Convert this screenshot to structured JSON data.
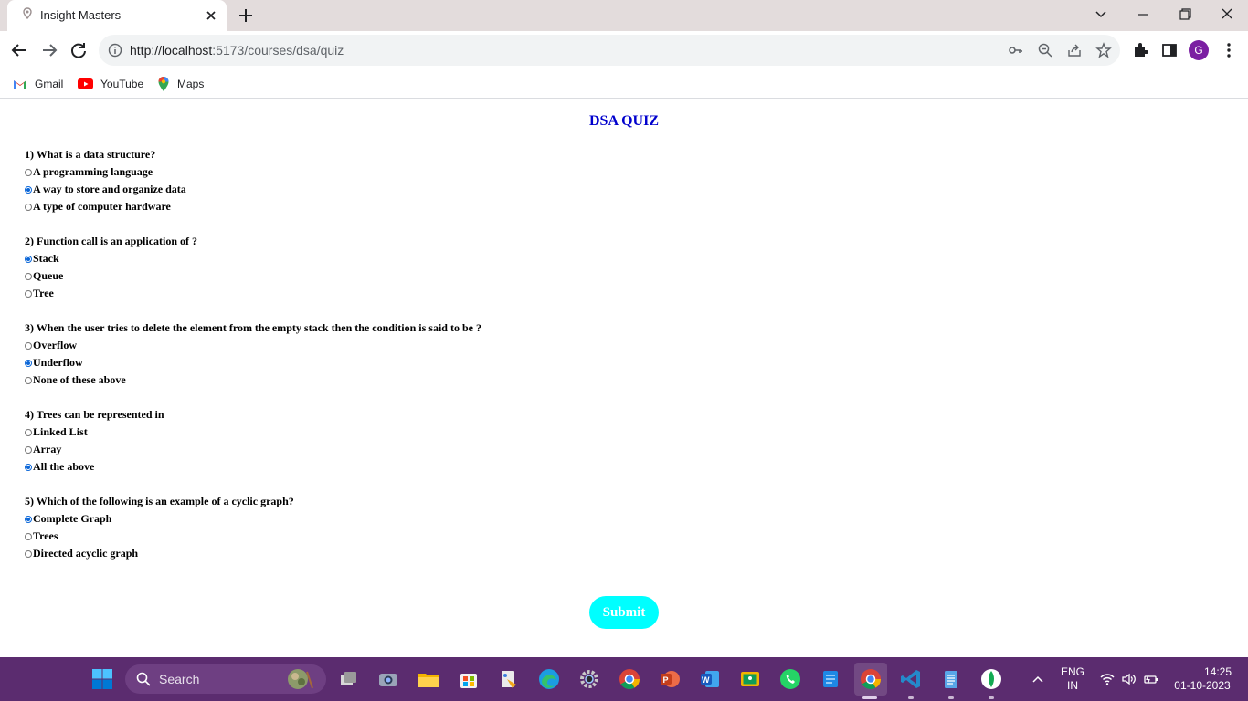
{
  "browser": {
    "tab_title": "Insight Masters",
    "url_scheme_host": "http://localhost",
    "url_rest": ":5173/courses/dsa/quiz",
    "profile_initial": "G",
    "bookmarks": [
      {
        "label": "Gmail",
        "icon": "gmail-icon"
      },
      {
        "label": "YouTube",
        "icon": "youtube-icon"
      },
      {
        "label": "Maps",
        "icon": "maps-icon"
      }
    ]
  },
  "quiz": {
    "title": "DSA QUIZ",
    "submit_label": "Submit",
    "questions": [
      {
        "text": "1) What is a data structure?",
        "options": [
          "A programming language",
          "A way to store and organize data",
          "A type of computer hardware"
        ],
        "selected": 1
      },
      {
        "text": "2) Function call is an application of ?",
        "options": [
          "Stack",
          "Queue",
          "Tree"
        ],
        "selected": 0
      },
      {
        "text": "3) When the user tries to delete the element from the empty stack then the condition is said to be ?",
        "options": [
          "Overflow",
          "Underflow",
          "None of these above"
        ],
        "selected": 1
      },
      {
        "text": "4) Trees can be represented in",
        "options": [
          "Linked List",
          "Array",
          "All the above"
        ],
        "selected": 2
      },
      {
        "text": "5) Which of the following is an example of a cyclic graph?",
        "options": [
          "Complete Graph",
          "Trees",
          "Directed acyclic graph"
        ],
        "selected": 0
      }
    ]
  },
  "taskbar": {
    "search_label": "Search",
    "language": "ENG",
    "region": "IN",
    "time": "14:25",
    "date": "01-10-2023",
    "accent": "#5b2c6f"
  },
  "colors": {
    "title": "#0000cd",
    "submit_bg": "#00ffff",
    "radio_checked": "#0a66d8"
  }
}
